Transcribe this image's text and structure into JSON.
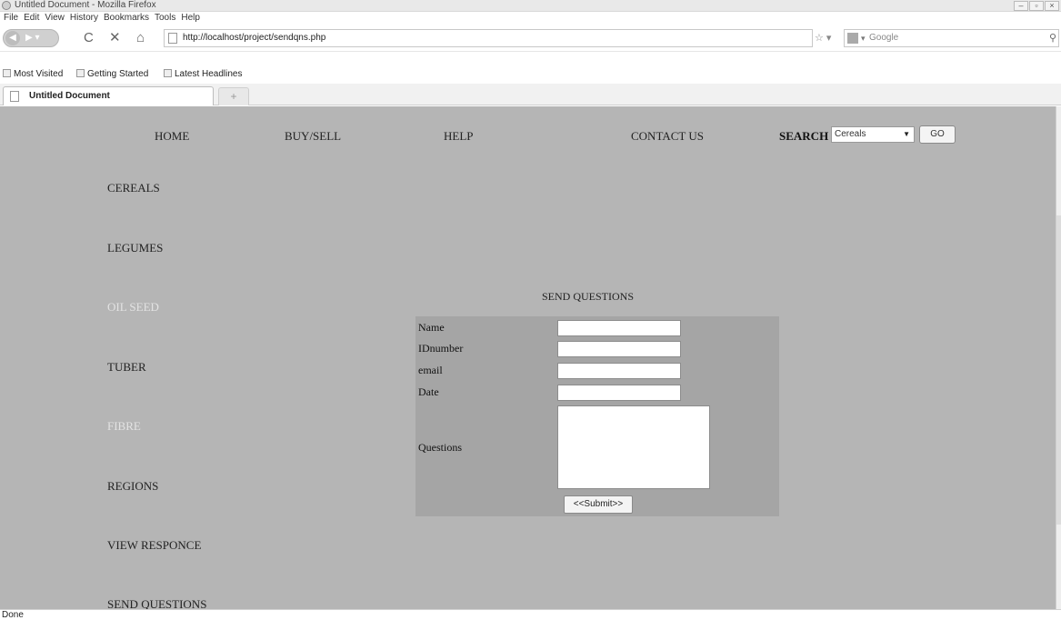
{
  "browser": {
    "window_title": "Untitled Document - Mozilla Firefox",
    "menu": [
      "File",
      "Edit",
      "View",
      "History",
      "Bookmarks",
      "Tools",
      "Help"
    ],
    "url": "http://localhost/project/sendqns.php",
    "search_placeholder": "Google",
    "bookmarks": [
      "Most Visited",
      "Getting Started",
      "Latest Headlines"
    ],
    "tab_title": "Untitled Document",
    "new_tab": "+",
    "status": "Done"
  },
  "nav": {
    "home": "HOME",
    "buy_sell": "BUY/SELL",
    "help": "HELP",
    "contact": "CONTACT US",
    "search_label": "SEARCH",
    "category_selected": "Cereals",
    "go": "GO"
  },
  "sidebar": [
    "CEREALS",
    "LEGUMES",
    "OIL SEED",
    "TUBER",
    "FIBRE",
    "REGIONS",
    "VIEW RESPONCE",
    "SEND QUESTIONS"
  ],
  "form": {
    "title": "SEND QUESTIONS",
    "labels": [
      "Name",
      "IDnumber",
      "email",
      "Date",
      "Questions"
    ],
    "submit": "<<Submit>>"
  }
}
